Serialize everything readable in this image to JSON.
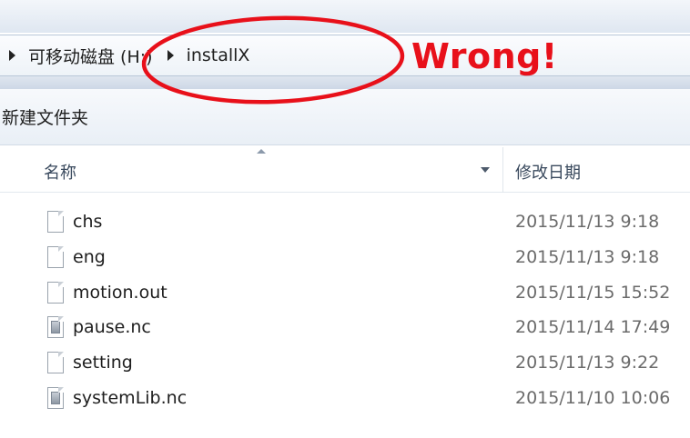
{
  "address_bar": {
    "crumbs": [
      "可移动磁盘 (H:)",
      "installX"
    ]
  },
  "toolbar": {
    "new_folder_label": "新建文件夹"
  },
  "columns": {
    "name_label": "名称",
    "date_label": "修改日期"
  },
  "files": [
    {
      "name": "chs",
      "date": "2015/11/13 9:18",
      "icon": "blank-file-icon"
    },
    {
      "name": "eng",
      "date": "2015/11/13 9:18",
      "icon": "blank-file-icon"
    },
    {
      "name": "motion.out",
      "date": "2015/11/15 15:52",
      "icon": "blank-file-icon"
    },
    {
      "name": "pause.nc",
      "date": "2015/11/14 17:49",
      "icon": "nc-file-icon"
    },
    {
      "name": "setting",
      "date": "2015/11/13 9:22",
      "icon": "blank-file-icon"
    },
    {
      "name": "systemLib.nc",
      "date": "2015/11/10 10:06",
      "icon": "nc-file-icon"
    }
  ],
  "annotation": {
    "label": "Wrong!",
    "color": "#e8101a"
  }
}
